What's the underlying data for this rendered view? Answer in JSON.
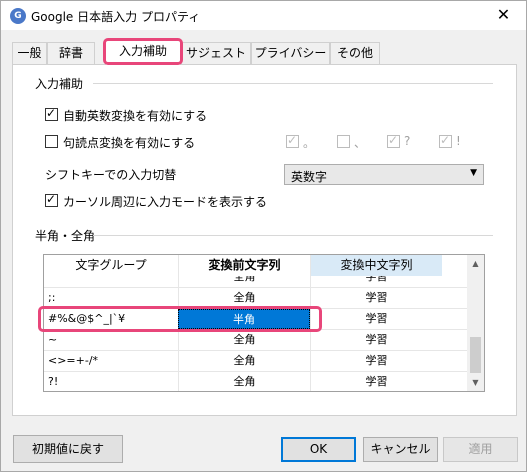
{
  "window": {
    "title": "Google 日本語入力 プロパティ",
    "close_glyph": "✕",
    "app_icon": "google-ime-icon"
  },
  "tabs": [
    {
      "label": "一般",
      "active": false
    },
    {
      "label": "辞書",
      "active": false
    },
    {
      "label": "入力補助",
      "active": true
    },
    {
      "label": "サジェスト",
      "active": false
    },
    {
      "label": "プライバシー",
      "active": false
    },
    {
      "label": "その他",
      "active": false
    }
  ],
  "input_assist": {
    "section_title": "入力補助",
    "auto_alnum": {
      "label": "自動英数変換を有効にする",
      "checked": true
    },
    "punctuation": {
      "label": "句読点変換を有効にする",
      "checked": false
    },
    "punct_options": [
      {
        "label": "。",
        "checked": true
      },
      {
        "label": "、",
        "checked": false
      },
      {
        "label": "?",
        "checked": true
      },
      {
        "label": "!",
        "checked": true
      }
    ],
    "shift_label": "シフトキーでの入力切替",
    "shift_value": "英数字",
    "cursor_mode": {
      "label": "カーソル周辺に入力モードを表示する",
      "checked": true
    }
  },
  "half_full": {
    "section_title": "半角・全角",
    "headers": [
      "文字グループ",
      "変換前文字列",
      "変換中文字列"
    ],
    "rows": [
      {
        "group": "",
        "before": "全角",
        "during": "学習"
      },
      {
        "group": ";:",
        "before": "全角",
        "during": "学習"
      },
      {
        "group": "#%&@$^_|`¥",
        "before": "半角",
        "during": "学習"
      },
      {
        "group": "~",
        "before": "全角",
        "during": "学習"
      },
      {
        "group": "<>=+-/*",
        "before": "全角",
        "during": "学習"
      },
      {
        "group": "?!",
        "before": "全角",
        "during": "学習"
      }
    ],
    "selected_row": 2,
    "accent_color": "#0078d7",
    "annotation_color": "#e8467a"
  },
  "buttons": {
    "reset": "初期値に戻す",
    "ok": "OK",
    "cancel": "キャンセル",
    "apply": "適用"
  }
}
